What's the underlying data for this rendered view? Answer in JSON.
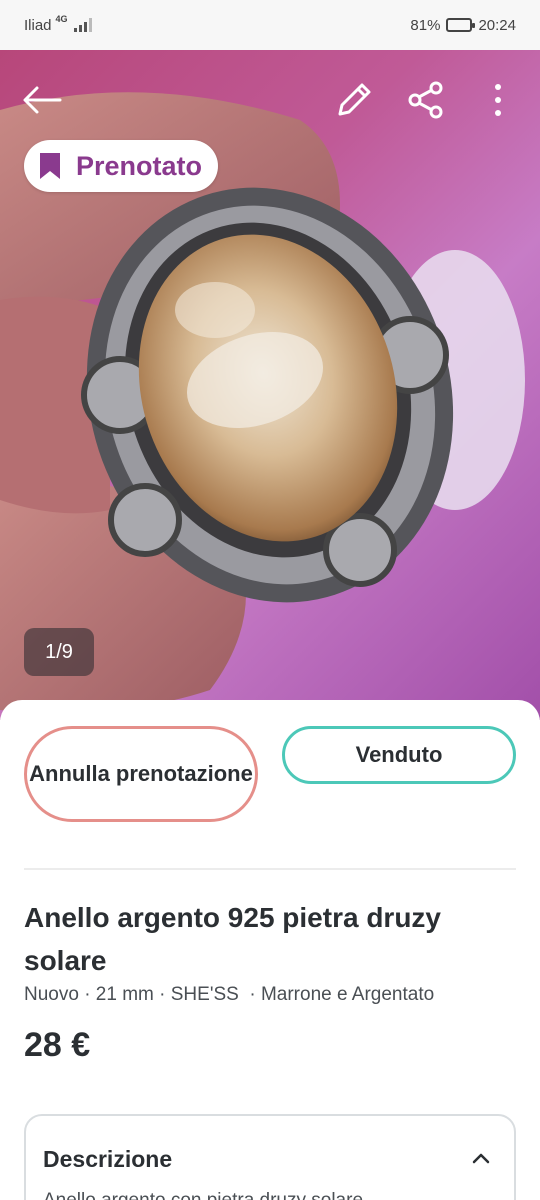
{
  "status_bar": {
    "carrier": "Iliad",
    "network": "4G",
    "battery_percent": "81%",
    "battery_level": 0.81,
    "time": "20:24"
  },
  "photo": {
    "counter": "1/9",
    "badge_label": "Prenotato",
    "badge_color": "#8a3a8e"
  },
  "actions": {
    "cancel_label": "Annulla prenotazione",
    "sold_label": "Venduto",
    "cancel_border": "#e58f8a",
    "sold_border": "#4cc8b8"
  },
  "item": {
    "title": "Anello argento 925 pietra druzy solare",
    "details": "Nuovo · 21 mm · SHE'SS  · Marrone e Argentato",
    "price": "28 €"
  },
  "description": {
    "heading": "Descrizione",
    "preview": "Anello argento con pietra druzy solare"
  },
  "icons": [
    "back-arrow-icon",
    "edit-pencil-icon",
    "share-icon",
    "more-vertical-icon",
    "bookmark-icon",
    "chevron-up-icon"
  ]
}
